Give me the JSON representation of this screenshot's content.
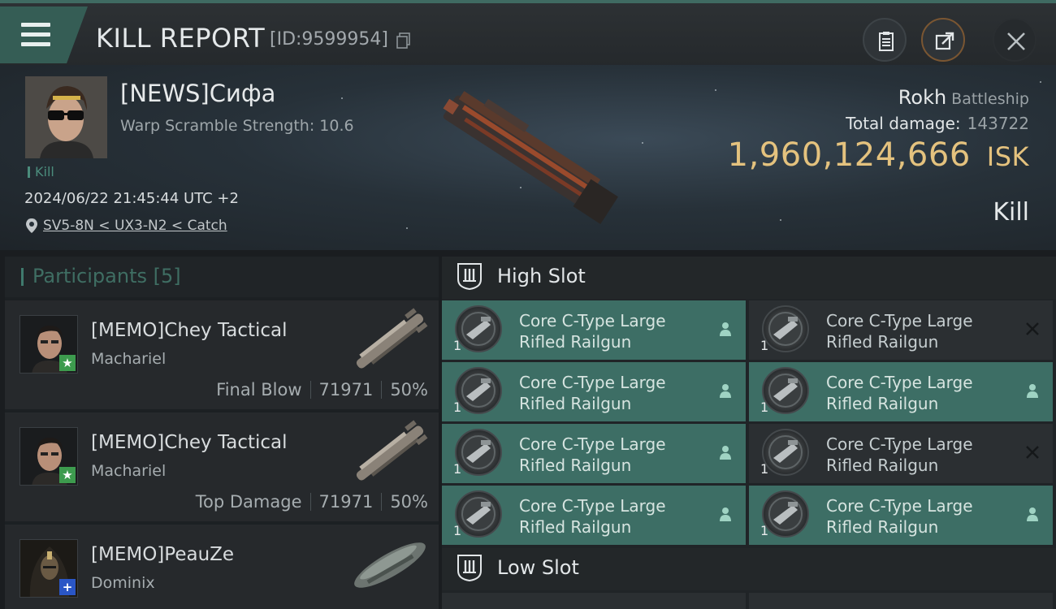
{
  "header": {
    "title": "KILL REPORT",
    "report_id": "[ID:9599954]",
    "buttons": [
      "clipboard",
      "share",
      "close"
    ]
  },
  "victim": {
    "name": "[NEWS]Сифа",
    "warp_scramble": "Warp Scramble Strength: 10.6",
    "kill_tag": "Kill",
    "datetime": "2024/06/22 21:45:44 UTC +2",
    "location": "SV5-8N < UX3-N2 < Catch",
    "ship_name": "Rokh",
    "ship_class": "Battleship",
    "total_damage_label": "Total damage:",
    "total_damage": "143722",
    "isk_value": "1,960,124,666",
    "isk_unit": "ISK",
    "report_type": "Kill"
  },
  "participants": {
    "title": "Participants",
    "count": "[5]",
    "items": [
      {
        "name": "[MEMO]Chey Tactical",
        "ship": "Machariel",
        "role": "Final Blow",
        "damage": "71971",
        "percent": "50%",
        "badge": "★"
      },
      {
        "name": "[MEMO]Chey Tactical",
        "ship": "Machariel",
        "role": "Top Damage",
        "damage": "71971",
        "percent": "50%",
        "badge": "★"
      },
      {
        "name": "[MEMO]PeauZe",
        "ship": "Dominix",
        "badge": "+"
      }
    ]
  },
  "fittings": {
    "high_slot_title": "High Slot",
    "low_slot_title": "Low Slot",
    "high_slot": [
      {
        "line1": "Core C-Type Large",
        "line2": "Rifled Railgun",
        "qty": "1",
        "status": "dropped"
      },
      {
        "line1": "Core C-Type Large",
        "line2": "Rifled Railgun",
        "qty": "1",
        "status": "destroyed"
      },
      {
        "line1": "Core C-Type Large",
        "line2": "Rifled Railgun",
        "qty": "1",
        "status": "dropped"
      },
      {
        "line1": "Core C-Type Large",
        "line2": "Rifled Railgun",
        "qty": "1",
        "status": "dropped"
      },
      {
        "line1": "Core C-Type Large",
        "line2": "Rifled Railgun",
        "qty": "1",
        "status": "dropped"
      },
      {
        "line1": "Core C-Type Large",
        "line2": "Rifled Railgun",
        "qty": "1",
        "status": "destroyed"
      },
      {
        "line1": "Core C-Type Large",
        "line2": "Rifled Railgun",
        "qty": "1",
        "status": "dropped"
      },
      {
        "line1": "Core C-Type Large",
        "line2": "Rifled Railgun",
        "qty": "1",
        "status": "dropped"
      }
    ]
  },
  "colors": {
    "accent": "#3d6e65",
    "isk_gold": "#e4c27e",
    "badge_green": "#3d9b4e",
    "badge_blue": "#2a56c6"
  }
}
